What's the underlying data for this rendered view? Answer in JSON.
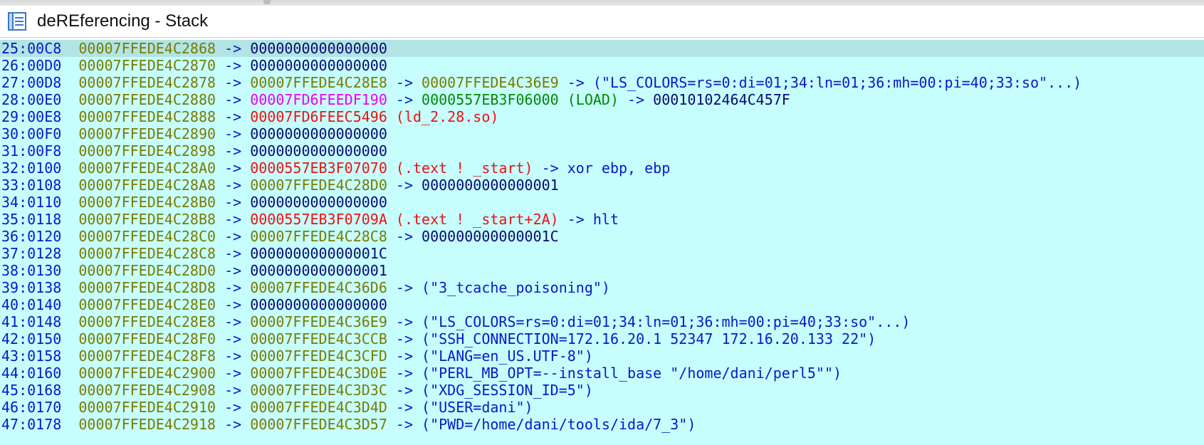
{
  "window": {
    "title": "deREferencing - Stack"
  },
  "colors": {
    "index": "#0a18c8",
    "address": "#7a7a00",
    "arrow": "#0a18c8",
    "value": "#0a0a6e",
    "magenta": "#ee00ee",
    "red": "#ee1111",
    "green": "#008800",
    "blue": "#0a18c8",
    "background": "#c6fefe",
    "highlight": "#b2e4e4"
  },
  "rows": [
    {
      "index": "25:00C8",
      "address": "00007FFEDE4C2868",
      "current": true,
      "parts": [
        {
          "t": "0000000000000000",
          "c": "value"
        }
      ]
    },
    {
      "index": "26:00D0",
      "address": "00007FFEDE4C2870",
      "parts": [
        {
          "t": "0000000000000000",
          "c": "value"
        }
      ]
    },
    {
      "index": "27:00D8",
      "address": "00007FFEDE4C2878",
      "parts": [
        {
          "t": "00007FFEDE4C28E8",
          "c": "address"
        },
        {
          "t": " -> ",
          "c": "arrow"
        },
        {
          "t": "00007FFEDE4C36E9",
          "c": "address"
        },
        {
          "t": " -> ",
          "c": "arrow"
        },
        {
          "t": "(\"LS_COLORS=rs=0:di=01;34:ln=01;36:mh=00:pi=40;33:so\"...)",
          "c": "blue"
        }
      ]
    },
    {
      "index": "28:00E0",
      "address": "00007FFEDE4C2880",
      "parts": [
        {
          "t": "00007FD6FEEDF190",
          "c": "magenta"
        },
        {
          "t": " -> ",
          "c": "arrow"
        },
        {
          "t": "0000557EB3F06000",
          "c": "green"
        },
        {
          "t": " (LOAD)",
          "c": "green"
        },
        {
          "t": " -> ",
          "c": "arrow"
        },
        {
          "t": "00010102464C457F",
          "c": "value"
        }
      ]
    },
    {
      "index": "29:00E8",
      "address": "00007FFEDE4C2888",
      "parts": [
        {
          "t": "00007FD6FEEC5496",
          "c": "red"
        },
        {
          "t": " (ld_2.28.so)",
          "c": "red"
        }
      ]
    },
    {
      "index": "30:00F0",
      "address": "00007FFEDE4C2890",
      "parts": [
        {
          "t": "0000000000000000",
          "c": "value"
        }
      ]
    },
    {
      "index": "31:00F8",
      "address": "00007FFEDE4C2898",
      "parts": [
        {
          "t": "0000000000000000",
          "c": "value"
        }
      ]
    },
    {
      "index": "32:0100",
      "address": "00007FFEDE4C28A0",
      "parts": [
        {
          "t": "0000557EB3F07070",
          "c": "red"
        },
        {
          "t": " (.text ! _start)",
          "c": "red"
        },
        {
          "t": " -> ",
          "c": "arrow"
        },
        {
          "t": "xor ebp, ebp",
          "c": "blue"
        }
      ]
    },
    {
      "index": "33:0108",
      "address": "00007FFEDE4C28A8",
      "parts": [
        {
          "t": "00007FFEDE4C28D0",
          "c": "address"
        },
        {
          "t": " -> ",
          "c": "arrow"
        },
        {
          "t": "0000000000000001",
          "c": "value"
        }
      ]
    },
    {
      "index": "34:0110",
      "address": "00007FFEDE4C28B0",
      "parts": [
        {
          "t": "0000000000000000",
          "c": "value"
        }
      ]
    },
    {
      "index": "35:0118",
      "address": "00007FFEDE4C28B8",
      "parts": [
        {
          "t": "0000557EB3F0709A",
          "c": "red"
        },
        {
          "t": " (.text ! _start+2A)",
          "c": "red"
        },
        {
          "t": " -> ",
          "c": "arrow"
        },
        {
          "t": "hlt",
          "c": "blue"
        }
      ]
    },
    {
      "index": "36:0120",
      "address": "00007FFEDE4C28C0",
      "parts": [
        {
          "t": "00007FFEDE4C28C8",
          "c": "address"
        },
        {
          "t": " -> ",
          "c": "arrow"
        },
        {
          "t": "000000000000001C",
          "c": "value"
        }
      ]
    },
    {
      "index": "37:0128",
      "address": "00007FFEDE4C28C8",
      "parts": [
        {
          "t": "000000000000001C",
          "c": "value"
        }
      ]
    },
    {
      "index": "38:0130",
      "address": "00007FFEDE4C28D0",
      "parts": [
        {
          "t": "0000000000000001",
          "c": "value"
        }
      ]
    },
    {
      "index": "39:0138",
      "address": "00007FFEDE4C28D8",
      "parts": [
        {
          "t": "00007FFEDE4C36D6",
          "c": "address"
        },
        {
          "t": " -> ",
          "c": "arrow"
        },
        {
          "t": "(\"3_tcache_poisoning\")",
          "c": "blue"
        }
      ]
    },
    {
      "index": "40:0140",
      "address": "00007FFEDE4C28E0",
      "parts": [
        {
          "t": "0000000000000000",
          "c": "value"
        }
      ]
    },
    {
      "index": "41:0148",
      "address": "00007FFEDE4C28E8",
      "parts": [
        {
          "t": "00007FFEDE4C36E9",
          "c": "address"
        },
        {
          "t": " -> ",
          "c": "arrow"
        },
        {
          "t": "(\"LS_COLORS=rs=0:di=01;34:ln=01;36:mh=00:pi=40;33:so\"...)",
          "c": "blue"
        }
      ]
    },
    {
      "index": "42:0150",
      "address": "00007FFEDE4C28F0",
      "parts": [
        {
          "t": "00007FFEDE4C3CCB",
          "c": "address"
        },
        {
          "t": " -> ",
          "c": "arrow"
        },
        {
          "t": "(\"SSH_CONNECTION=172.16.20.1 52347 172.16.20.133 22\")",
          "c": "blue"
        }
      ]
    },
    {
      "index": "43:0158",
      "address": "00007FFEDE4C28F8",
      "parts": [
        {
          "t": "00007FFEDE4C3CFD",
          "c": "address"
        },
        {
          "t": " -> ",
          "c": "arrow"
        },
        {
          "t": "(\"LANG=en_US.UTF-8\")",
          "c": "blue"
        }
      ]
    },
    {
      "index": "44:0160",
      "address": "00007FFEDE4C2900",
      "parts": [
        {
          "t": "00007FFEDE4C3D0E",
          "c": "address"
        },
        {
          "t": " -> ",
          "c": "arrow"
        },
        {
          "t": "(\"PERL_MB_OPT=--install_base \"/home/dani/perl5\"\")",
          "c": "blue"
        }
      ]
    },
    {
      "index": "45:0168",
      "address": "00007FFEDE4C2908",
      "parts": [
        {
          "t": "00007FFEDE4C3D3C",
          "c": "address"
        },
        {
          "t": " -> ",
          "c": "arrow"
        },
        {
          "t": "(\"XDG_SESSION_ID=5\")",
          "c": "blue"
        }
      ]
    },
    {
      "index": "46:0170",
      "address": "00007FFEDE4C2910",
      "parts": [
        {
          "t": "00007FFEDE4C3D4D",
          "c": "address"
        },
        {
          "t": " -> ",
          "c": "arrow"
        },
        {
          "t": "(\"USER=dani\")",
          "c": "blue"
        }
      ]
    },
    {
      "index": "47:0178",
      "address": "00007FFEDE4C2918",
      "parts": [
        {
          "t": "00007FFEDE4C3D57",
          "c": "address"
        },
        {
          "t": " -> ",
          "c": "arrow"
        },
        {
          "t": "(\"PWD=/home/dani/tools/ida/7_3\")",
          "c": "blue"
        }
      ]
    }
  ]
}
